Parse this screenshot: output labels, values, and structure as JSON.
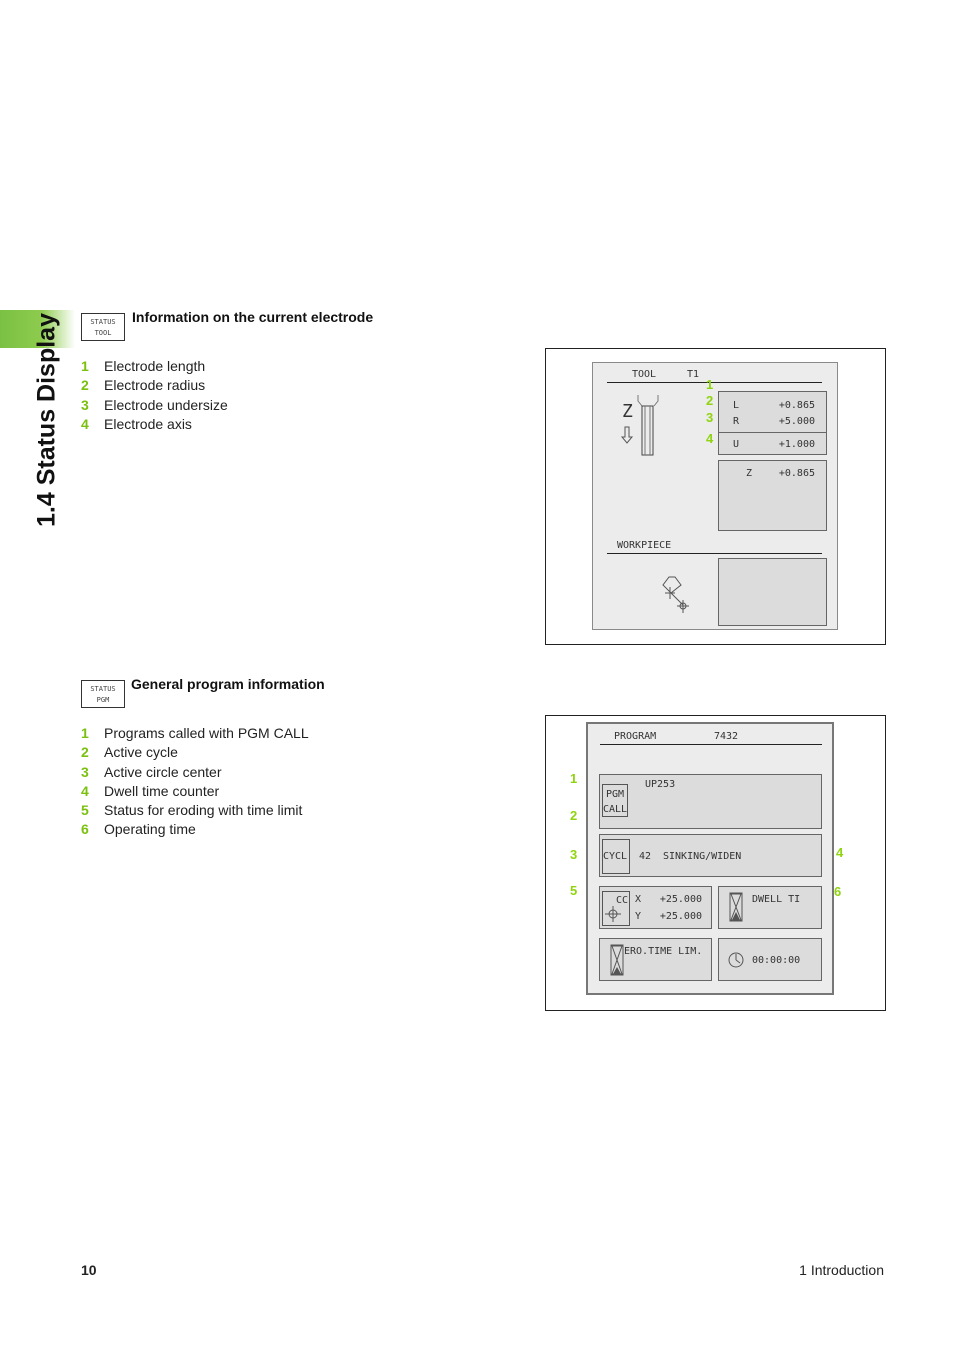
{
  "sidebar": {
    "chapter_title": "1.4 Status Display"
  },
  "section1": {
    "key_lines": [
      "STATUS",
      "TOOL"
    ],
    "heading": "Information on the current electrode",
    "items": [
      {
        "num": "1",
        "label": "Electrode length"
      },
      {
        "num": "2",
        "label": "Electrode radius"
      },
      {
        "num": "3",
        "label": "Electrode undersize"
      },
      {
        "num": "4",
        "label": "Electrode axis"
      }
    ],
    "screen": {
      "tool_label": "TOOL",
      "tool_id": "T1",
      "axis_letter": "Z",
      "rows": [
        {
          "name": "L",
          "value": "+0.865"
        },
        {
          "name": "R",
          "value": "+5.000"
        },
        {
          "name": "U",
          "value": "+1.000"
        }
      ],
      "axis_row": {
        "name": "Z",
        "value": "+0.865"
      },
      "workpiece_label": "WORKPIECE",
      "callouts": [
        "1",
        "2",
        "3",
        "4"
      ]
    }
  },
  "section2": {
    "key_lines": [
      "STATUS",
      "PGM"
    ],
    "heading": "General program information",
    "items": [
      {
        "num": "1",
        "label": "Programs called with PGM CALL"
      },
      {
        "num": "2",
        "label": "Active cycle"
      },
      {
        "num": "3",
        "label": "Active circle center"
      },
      {
        "num": "4",
        "label": "Dwell time counter"
      },
      {
        "num": "5",
        "label": "Status for eroding with time limit"
      },
      {
        "num": "6",
        "label": "Operating time"
      }
    ],
    "screen": {
      "program_label": "PROGRAM",
      "program_id": "7432",
      "pgm_call": {
        "icon_lines": [
          "PGM",
          "CALL"
        ],
        "value": "UP253"
      },
      "cycle": {
        "icon": "CYCL",
        "number": "42",
        "name": "SINKING/WIDEN"
      },
      "circle_center": {
        "icon": "CC",
        "x_label": "X",
        "x_value": "+25.000",
        "y_label": "Y",
        "y_value": "+25.000"
      },
      "dwell": {
        "label": "DWELL TI"
      },
      "ero_time": {
        "label": "ERO.TIME LIM."
      },
      "operating_time": {
        "value": "00:00:00"
      },
      "callouts": [
        "1",
        "2",
        "3",
        "4",
        "5",
        "6"
      ]
    }
  },
  "footer": {
    "page_number": "10",
    "chapter": "1 Introduction"
  }
}
